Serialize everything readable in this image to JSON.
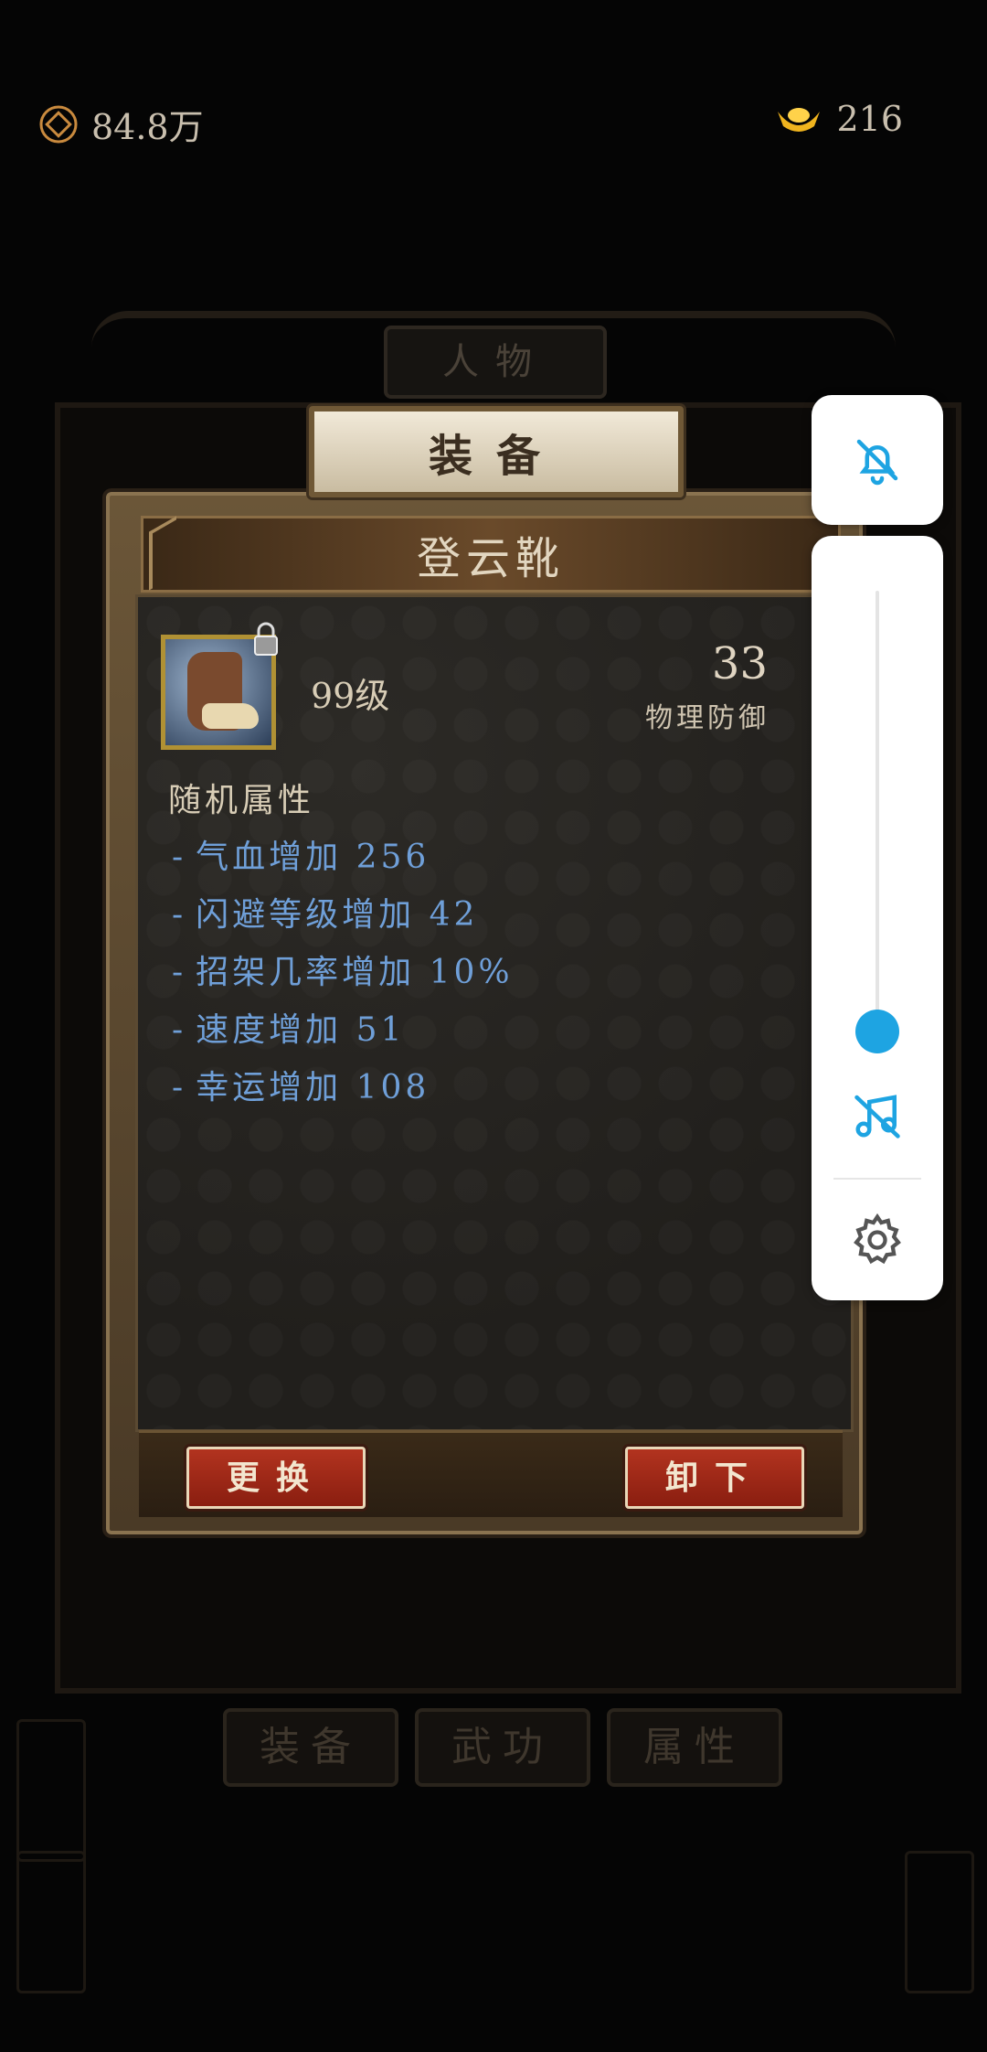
{
  "currency": {
    "coins": "84.8万",
    "ingots": "216"
  },
  "background": {
    "title": "人物",
    "tabs": [
      "装备",
      "武功",
      "属性"
    ]
  },
  "panel": {
    "tab_label": "装备",
    "item_name": "登云靴",
    "level": "99级",
    "stat_value": "33",
    "stat_label": "物理防御",
    "random_title": "随机属性",
    "attributes": [
      "气血增加 256",
      "闪避等级增加 42",
      "招架几率增加 10%",
      "速度增加 51",
      "幸运增加 108"
    ],
    "buttons": {
      "change": "更换",
      "unequip": "卸下"
    }
  },
  "volume_panel": {
    "level": 0.0,
    "accent": "#1ea4e2"
  }
}
